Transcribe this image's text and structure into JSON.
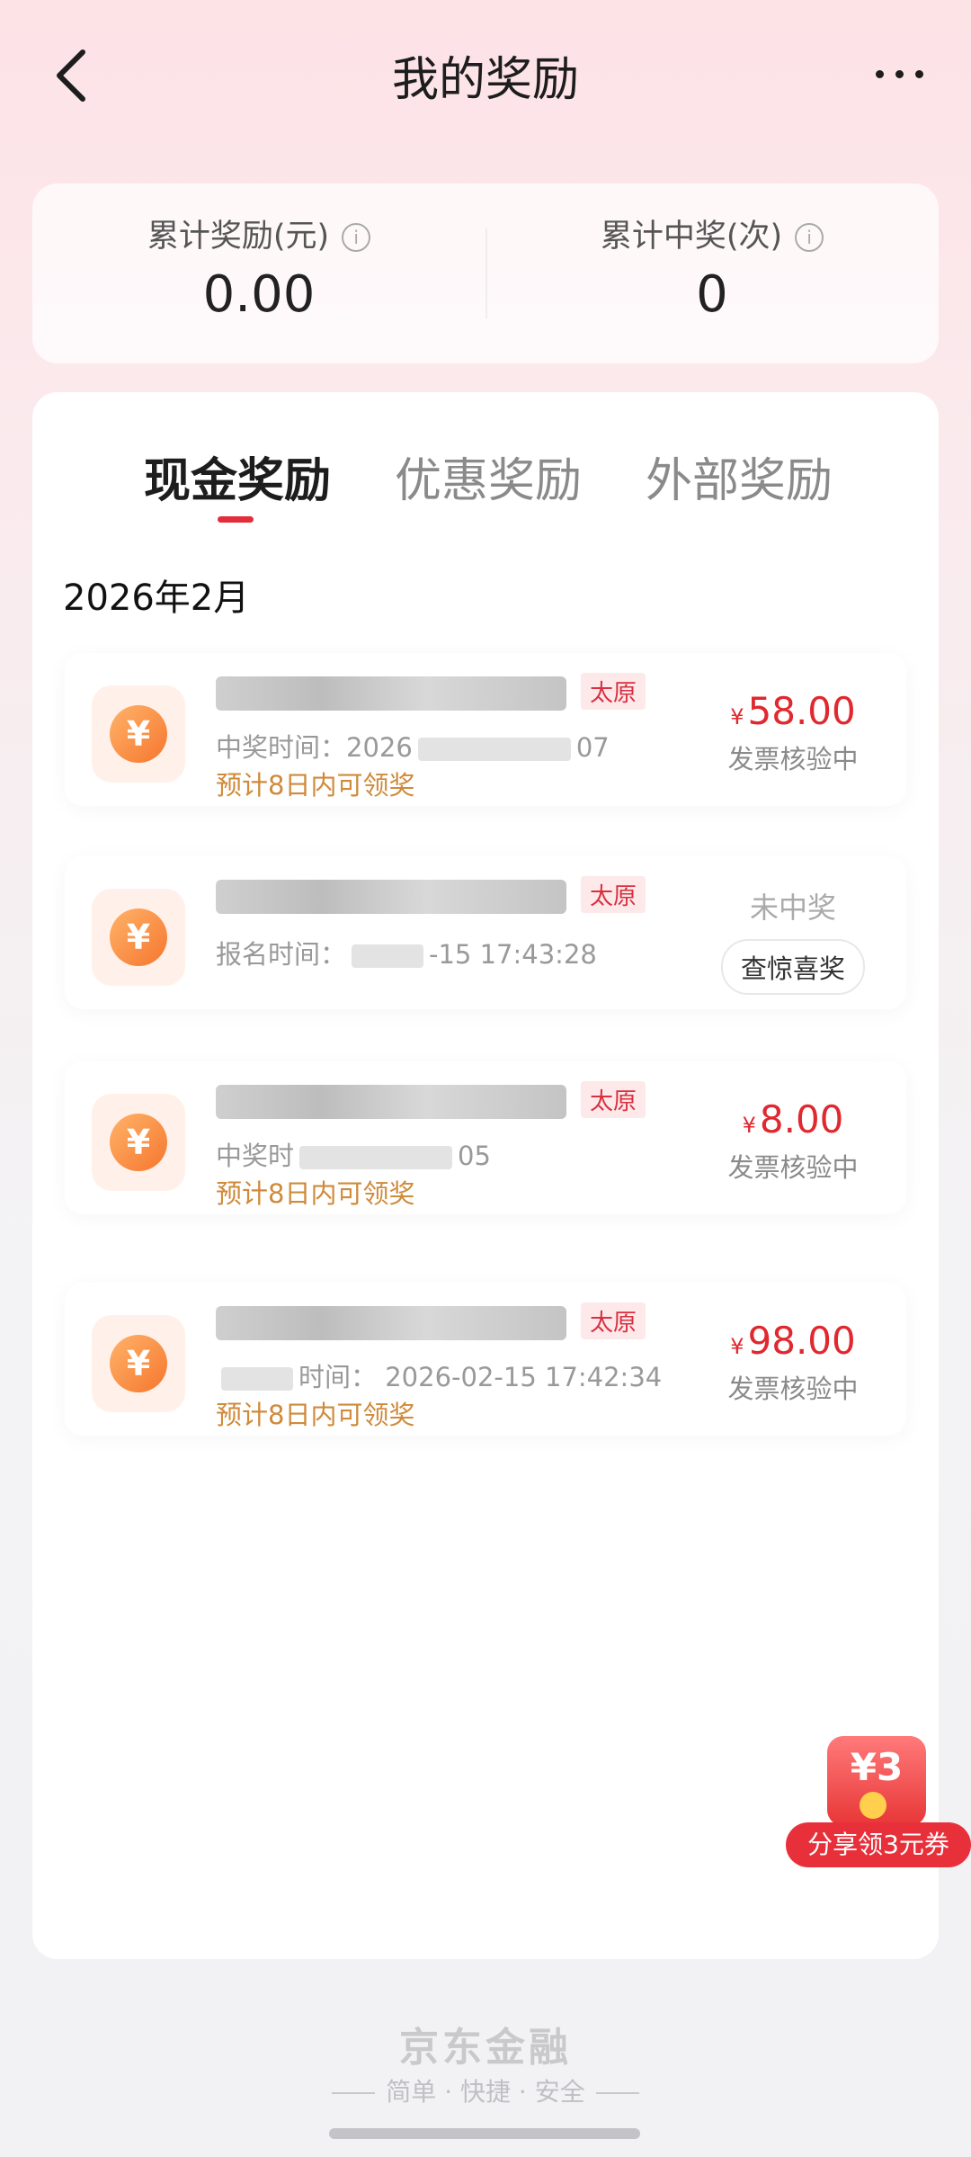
{
  "header": {
    "title": "我的奖励",
    "back_icon": "chevron-left-icon",
    "more_icon": "more-dots-icon"
  },
  "stats": {
    "total_reward": {
      "label": "累计奖励(元)",
      "value": "0.00",
      "icon": "info-icon"
    },
    "total_wins": {
      "label": "累计中奖(次)",
      "value": "0",
      "icon": "info-icon"
    }
  },
  "tabs": [
    {
      "label": "现金奖励",
      "active": true
    },
    {
      "label": "优惠奖励",
      "active": false
    },
    {
      "label": "外部奖励",
      "active": false
    }
  ],
  "month_heading": "2026年2月",
  "rewards": [
    {
      "tag": "太原",
      "time_prefix": "中奖时间：",
      "time_visible": "2026",
      "time_tail": "07",
      "note": "预计8日内可领奖",
      "currency": "¥",
      "amount": "58.00",
      "status": "发票核验中"
    },
    {
      "tag": "太原",
      "time_prefix": "报名时间：",
      "time_visible": "",
      "time_tail": "-15 17:43:28",
      "status": "未中奖",
      "button": "查惊喜奖"
    },
    {
      "tag": "太原",
      "time_prefix": "中奖时",
      "time_visible": "",
      "time_tail": "05",
      "note": "预计8日内可领奖",
      "currency": "¥",
      "amount": "8.00",
      "status": "发票核验中"
    },
    {
      "tag": "太原",
      "time_prefix": "",
      "time_visible": "时间：",
      "time_tail": "2026-02-15 17:42:34",
      "note": "预计8日内可领奖",
      "currency": "¥",
      "amount": "98.00",
      "status": "发票核验中"
    }
  ],
  "floating_promo": {
    "badge_text": "¥3",
    "label": "分享领3元券"
  },
  "footer": {
    "brand": "京东金融",
    "slogan": "简单 · 快捷 · 安全"
  },
  "colors": {
    "accent": "#e42d3b",
    "amount": "#e0282f",
    "note": "#cf8a3a"
  }
}
